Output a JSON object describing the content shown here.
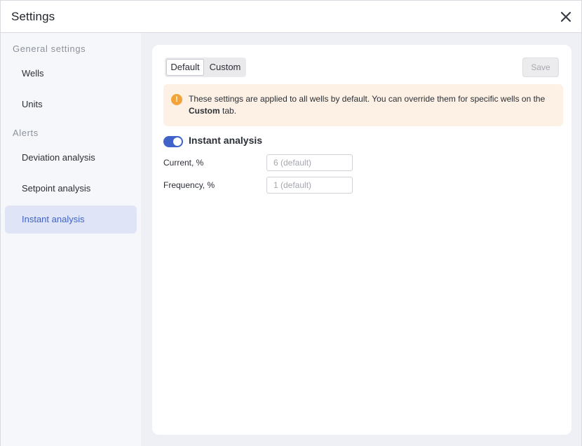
{
  "window": {
    "title": "Settings"
  },
  "sidebar": {
    "sections": [
      {
        "label": "General settings",
        "items": [
          {
            "label": "Wells",
            "active": false
          },
          {
            "label": "Units",
            "active": false
          }
        ]
      },
      {
        "label": "Alerts",
        "items": [
          {
            "label": "Deviation analysis",
            "active": false
          },
          {
            "label": "Setpoint analysis",
            "active": false
          },
          {
            "label": "Instant analysis",
            "active": true
          }
        ]
      }
    ]
  },
  "main": {
    "tabs": [
      {
        "label": "Default",
        "selected": true
      },
      {
        "label": "Custom",
        "selected": false
      }
    ],
    "save_label": "Save",
    "save_enabled": false,
    "banner": {
      "icon": "warning-icon",
      "text_before": "These settings are applied to all wells by default. You can override them for specific wells on the ",
      "text_bold": "Custom",
      "text_after": " tab."
    },
    "toggle": {
      "label": "Instant analysis",
      "enabled": true
    },
    "fields": [
      {
        "label": "Current, %",
        "value": "",
        "placeholder": "6 (default)"
      },
      {
        "label": "Frequency, %",
        "value": "",
        "placeholder": "1 (default)"
      }
    ]
  },
  "colors": {
    "accent": "#3f63c9",
    "warning": "#f2a43a",
    "banner_bg": "#fdf1e5",
    "sidebar_bg": "#f6f7fb",
    "active_item_bg": "#dfe4f6"
  }
}
